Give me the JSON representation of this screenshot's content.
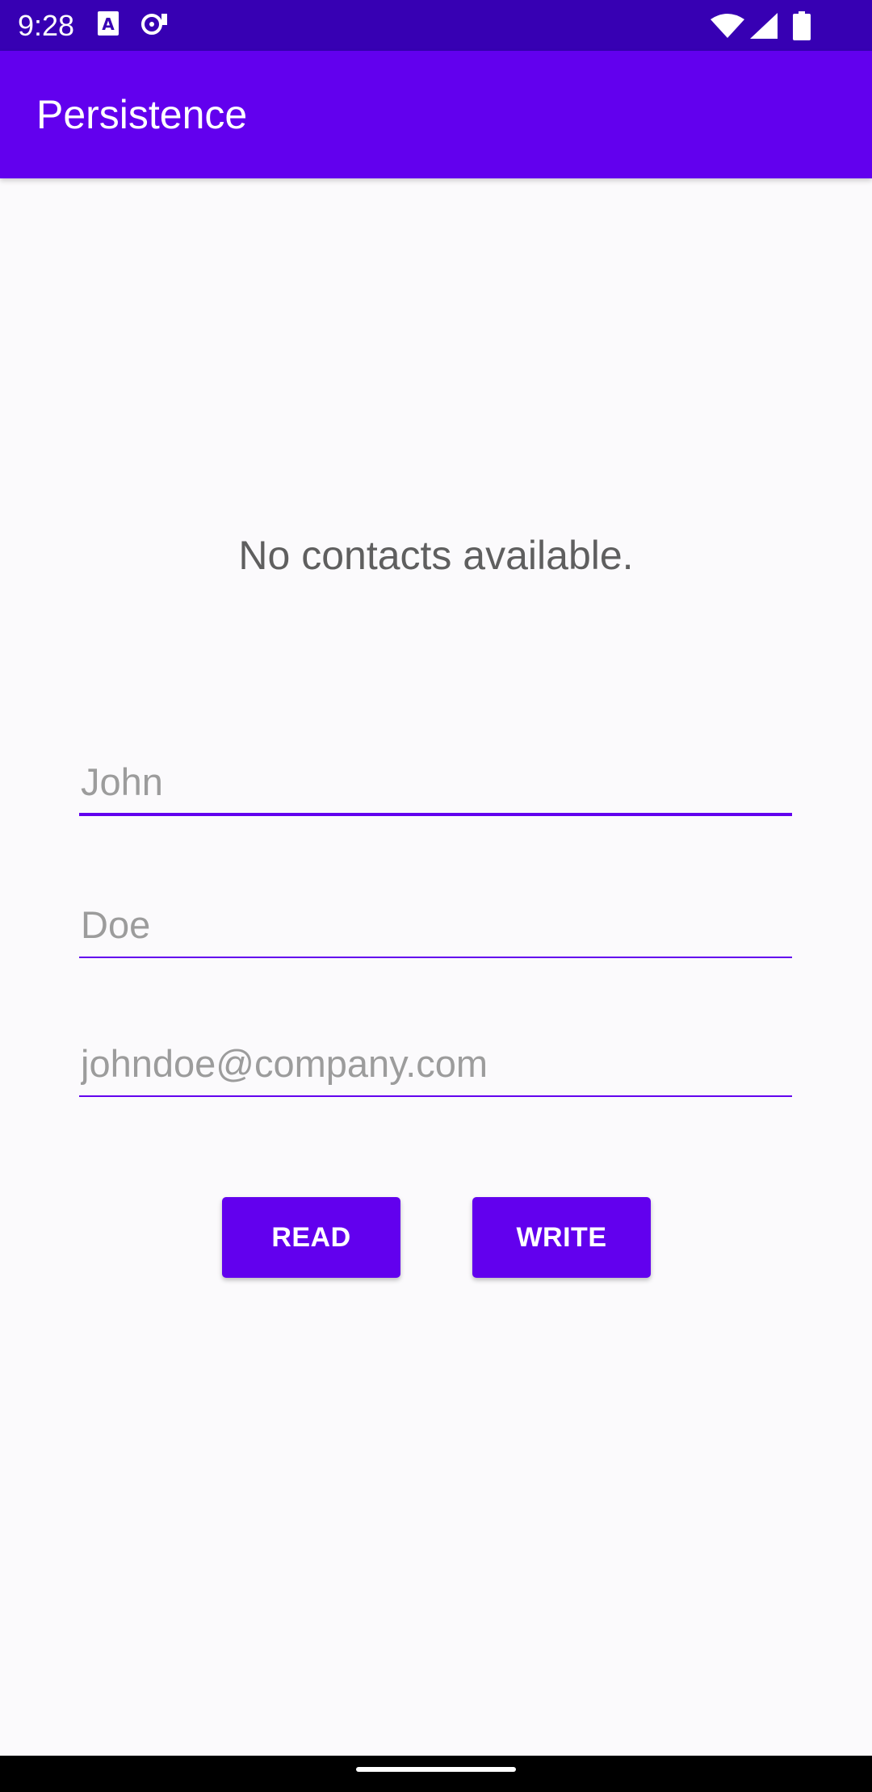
{
  "status_bar": {
    "time": "9:28",
    "icons": [
      "a-notification-icon",
      "media-notification-icon",
      "wifi-icon",
      "signal-icon",
      "battery-icon"
    ]
  },
  "app_bar": {
    "title": "Persistence"
  },
  "main": {
    "empty_message": "No contacts available.",
    "fields": [
      {
        "placeholder": "John",
        "value": ""
      },
      {
        "placeholder": "Doe",
        "value": ""
      },
      {
        "placeholder": "johndoe@company.com",
        "value": ""
      }
    ],
    "buttons": {
      "read_label": "READ",
      "write_label": "WRITE"
    }
  },
  "colors": {
    "primary": "#6200ee",
    "primary_dark": "#3700b3",
    "background": "#fbfafc"
  }
}
